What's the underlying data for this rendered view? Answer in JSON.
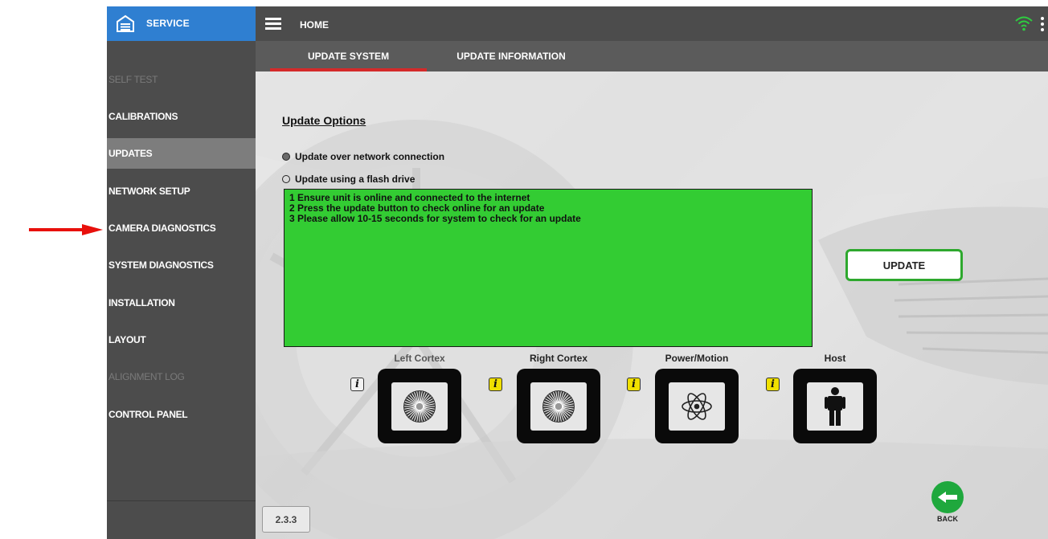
{
  "app": {
    "section_title": "SERVICE",
    "page_title": "HOME",
    "version": "2.3.3"
  },
  "sidebar": {
    "items": [
      {
        "label": "SELF TEST",
        "state": "disabled"
      },
      {
        "label": "CALIBRATIONS",
        "state": "normal"
      },
      {
        "label": "UPDATES",
        "state": "active"
      },
      {
        "label": "NETWORK SETUP",
        "state": "normal"
      },
      {
        "label": "CAMERA DIAGNOSTICS",
        "state": "normal"
      },
      {
        "label": "SYSTEM DIAGNOSTICS",
        "state": "normal"
      },
      {
        "label": "INSTALLATION",
        "state": "normal"
      },
      {
        "label": "LAYOUT",
        "state": "normal"
      },
      {
        "label": "ALIGNMENT LOG",
        "state": "disabled"
      },
      {
        "label": "CONTROL PANEL",
        "state": "normal"
      }
    ]
  },
  "tabs": [
    {
      "label": "UPDATE SYSTEM",
      "active": true
    },
    {
      "label": "UPDATE INFORMATION",
      "active": false
    }
  ],
  "update_options": {
    "title": "Update Options",
    "options": [
      {
        "label": "Update over network connection",
        "selected": true
      },
      {
        "label": "Update using a flash drive",
        "selected": false
      }
    ],
    "instructions": [
      "1 Ensure unit is online and connected to the internet",
      "2 Press the update button to check online for an update",
      "3 Please allow 10-15 seconds for system to check for an update"
    ],
    "update_button": "UPDATE"
  },
  "components": [
    {
      "label": "Left Cortex",
      "icon": "cortex-target-icon",
      "info_color": "white"
    },
    {
      "label": "Right Cortex",
      "icon": "cortex-target-icon",
      "info_color": "yellow"
    },
    {
      "label": "Power/Motion",
      "icon": "atom-icon",
      "info_color": "yellow"
    },
    {
      "label": "Host",
      "icon": "person-icon",
      "info_color": "yellow"
    }
  ],
  "info_glyph": "i",
  "back_label": "BACK",
  "colors": {
    "sidebar_bg": "#4c4c4c",
    "header_accent": "#2f7fd1",
    "active_tab_underline": "#d42a2a",
    "message_box": "#33cc33",
    "update_button_border": "#2ea82e",
    "back_button": "#1fa83d",
    "wifi": "#2ecc40",
    "annotation_arrow": "#e8100c"
  }
}
